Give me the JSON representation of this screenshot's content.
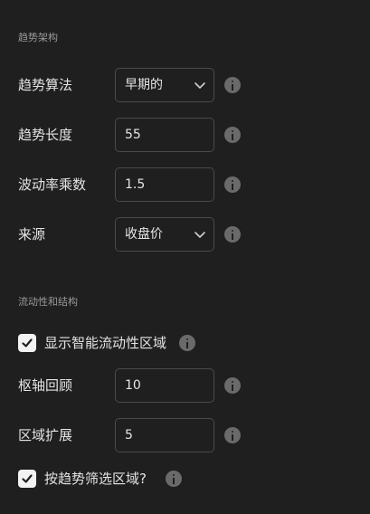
{
  "trend_section": {
    "title": "趋势架构",
    "algorithm": {
      "label": "趋势算法",
      "value": "早期的"
    },
    "length": {
      "label": "趋势长度",
      "value": "55"
    },
    "volatility_multiplier": {
      "label": "波动率乘数",
      "value": "1.5"
    },
    "source": {
      "label": "来源",
      "value": "收盘价"
    }
  },
  "liquidity_section": {
    "title": "流动性和结构",
    "show_zones": {
      "label": "显示智能流动性区域",
      "checked": true
    },
    "pivot_lookback": {
      "label": "枢轴回顾",
      "value": "10"
    },
    "zone_extension": {
      "label": "区域扩展",
      "value": "5"
    },
    "filter_by_trend": {
      "label": "按趋势筛选区域?",
      "checked": true
    }
  },
  "icons": {
    "info": "info-icon",
    "chevron": "chevron-down-icon",
    "check": "checkmark-icon"
  },
  "colors": {
    "background": "#1f1f1f",
    "text": "#e3e3e3",
    "section_title": "#9a9a9a",
    "field_border": "#4a4a4a",
    "info_icon": "#6a6a6a",
    "checkbox_fill": "#f2f2f2"
  }
}
